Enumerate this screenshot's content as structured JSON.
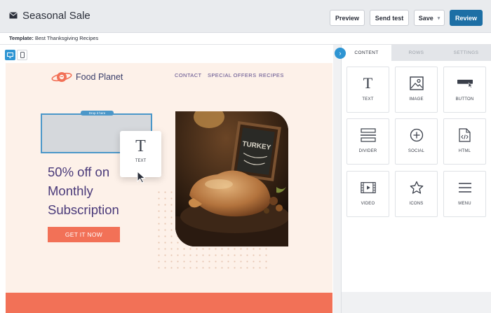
{
  "app": {
    "title": "Seasonal Sale",
    "template_label": "Template:",
    "template_name": "Best Thanksgiving Recipes"
  },
  "toolbar": {
    "preview_label": "Preview",
    "send_test_label": "Send test",
    "save_label": "Save",
    "review_label": "Review"
  },
  "email": {
    "brand_name": "Food Planet",
    "nav": [
      "CONTACT",
      "SPECIAL OFFERS",
      "RECIPES"
    ],
    "drop_tag": "Drop it here",
    "headline_lines": [
      "50% off on",
      "Monthly",
      "Subscription"
    ],
    "cta_label": "GET IT NOW",
    "photo_sign": "TURKEY"
  },
  "drag_item": {
    "glyph": "T",
    "label": "TEXT"
  },
  "panel": {
    "tabs": [
      "CONTENT",
      "ROWS",
      "SETTINGS"
    ],
    "active_tab": "CONTENT",
    "blocks": [
      {
        "label": "TEXT",
        "icon": "text-icon"
      },
      {
        "label": "IMAGE",
        "icon": "image-icon"
      },
      {
        "label": "BUTTON",
        "icon": "button-icon"
      },
      {
        "label": "DIVIDER",
        "icon": "divider-icon"
      },
      {
        "label": "SOCIAL",
        "icon": "social-icon"
      },
      {
        "label": "HTML",
        "icon": "html-icon"
      },
      {
        "label": "VIDEO",
        "icon": "video-icon"
      },
      {
        "label": "ICONS",
        "icon": "icons-icon"
      },
      {
        "label": "MENU",
        "icon": "menu-icon"
      }
    ]
  },
  "colors": {
    "accent_blue": "#1d6fa5",
    "device_blue": "#2e95d3",
    "cta_coral": "#f27157",
    "email_bg": "#fdf1e9",
    "headline_purple": "#4a3a7a"
  }
}
